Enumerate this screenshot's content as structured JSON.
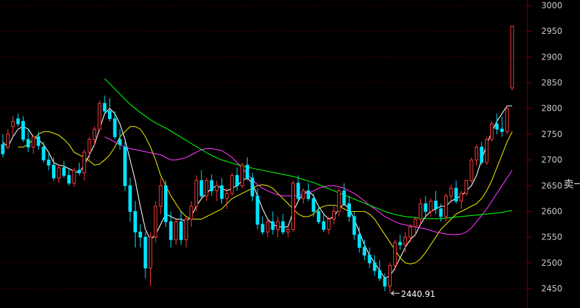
{
  "colors": {
    "background": "#000000",
    "grid": "#7a0000",
    "axis_text": "#c8c8c8",
    "up_candle": "#ff3c3c",
    "down_candle": "#00e5ff",
    "ma5": "#ffffff",
    "ma10": "#e6e600",
    "ma20": "#ff33ff",
    "ma60": "#00ff00",
    "annotation": "#ffffff"
  },
  "side_tab": {
    "label": "卖一"
  },
  "chart_data": {
    "type": "candlestick",
    "ylim": [
      2440,
      3000
    ],
    "y_ticks": [
      3000,
      2950,
      2900,
      2850,
      2800,
      2750,
      2700,
      2650,
      2600,
      2550,
      2500,
      2450
    ],
    "grid": true,
    "annotation": {
      "text": "2440.91",
      "value": 2440.91
    },
    "candles": [
      [
        2730,
        2750,
        2705,
        2712
      ],
      [
        2725,
        2760,
        2720,
        2750
      ],
      [
        2765,
        2785,
        2745,
        2775
      ],
      [
        2780,
        2790,
        2765,
        2770
      ],
      [
        2775,
        2785,
        2735,
        2740
      ],
      [
        2740,
        2760,
        2715,
        2725
      ],
      [
        2725,
        2748,
        2712,
        2745
      ],
      [
        2745,
        2755,
        2720,
        2728
      ],
      [
        2725,
        2735,
        2695,
        2700
      ],
      [
        2700,
        2712,
        2680,
        2690
      ],
      [
        2690,
        2705,
        2660,
        2665
      ],
      [
        2665,
        2690,
        2655,
        2685
      ],
      [
        2685,
        2698,
        2665,
        2670
      ],
      [
        2670,
        2682,
        2650,
        2655
      ],
      [
        2655,
        2685,
        2648,
        2680
      ],
      [
        2680,
        2695,
        2670,
        2675
      ],
      [
        2675,
        2720,
        2660,
        2715
      ],
      [
        2715,
        2745,
        2700,
        2740
      ],
      [
        2740,
        2765,
        2730,
        2760
      ],
      [
        2760,
        2815,
        2755,
        2810
      ],
      [
        2810,
        2825,
        2790,
        2795
      ],
      [
        2795,
        2820,
        2775,
        2780
      ],
      [
        2780,
        2795,
        2740,
        2745
      ],
      [
        2740,
        2760,
        2720,
        2730
      ],
      [
        2725,
        2735,
        2640,
        2650
      ],
      [
        2650,
        2665,
        2580,
        2600
      ],
      [
        2600,
        2620,
        2530,
        2560
      ],
      [
        2560,
        2575,
        2530,
        2550
      ],
      [
        2550,
        2560,
        2470,
        2490
      ],
      [
        2490,
        2560,
        2455,
        2550
      ],
      [
        2550,
        2620,
        2540,
        2610
      ],
      [
        2610,
        2665,
        2595,
        2650
      ],
      [
        2650,
        2660,
        2570,
        2580
      ],
      [
        2580,
        2600,
        2530,
        2545
      ],
      [
        2545,
        2585,
        2535,
        2580
      ],
      [
        2580,
        2600,
        2535,
        2545
      ],
      [
        2545,
        2590,
        2530,
        2585
      ],
      [
        2585,
        2620,
        2570,
        2610
      ],
      [
        2610,
        2670,
        2600,
        2660
      ],
      [
        2660,
        2680,
        2625,
        2630
      ],
      [
        2630,
        2665,
        2620,
        2660
      ],
      [
        2660,
        2672,
        2630,
        2640
      ],
      [
        2640,
        2660,
        2620,
        2650
      ],
      [
        2650,
        2665,
        2615,
        2625
      ],
      [
        2625,
        2645,
        2605,
        2635
      ],
      [
        2635,
        2675,
        2630,
        2670
      ],
      [
        2670,
        2685,
        2640,
        2650
      ],
      [
        2650,
        2695,
        2645,
        2690
      ],
      [
        2690,
        2705,
        2660,
        2665
      ],
      [
        2665,
        2675,
        2620,
        2630
      ],
      [
        2630,
        2645,
        2565,
        2575
      ],
      [
        2575,
        2590,
        2555,
        2560
      ],
      [
        2560,
        2585,
        2550,
        2580
      ],
      [
        2580,
        2600,
        2555,
        2565
      ],
      [
        2565,
        2590,
        2550,
        2580
      ],
      [
        2580,
        2595,
        2555,
        2560
      ],
      [
        2560,
        2575,
        2550,
        2565
      ],
      [
        2565,
        2660,
        2560,
        2655
      ],
      [
        2655,
        2670,
        2620,
        2625
      ],
      [
        2625,
        2645,
        2615,
        2640
      ],
      [
        2640,
        2655,
        2620,
        2625
      ],
      [
        2625,
        2635,
        2590,
        2600
      ],
      [
        2600,
        2610,
        2575,
        2580
      ],
      [
        2580,
        2595,
        2560,
        2565
      ],
      [
        2565,
        2590,
        2555,
        2585
      ],
      [
        2585,
        2610,
        2575,
        2600
      ],
      [
        2600,
        2645,
        2590,
        2640
      ],
      [
        2640,
        2655,
        2610,
        2615
      ],
      [
        2615,
        2630,
        2580,
        2590
      ],
      [
        2590,
        2600,
        2545,
        2555
      ],
      [
        2555,
        2570,
        2520,
        2530
      ],
      [
        2530,
        2545,
        2505,
        2515
      ],
      [
        2515,
        2530,
        2490,
        2500
      ],
      [
        2500,
        2515,
        2475,
        2485
      ],
      [
        2485,
        2505,
        2465,
        2470
      ],
      [
        2470,
        2480,
        2445,
        2455
      ],
      [
        2455,
        2500,
        2441,
        2495
      ],
      [
        2495,
        2545,
        2485,
        2540
      ],
      [
        2540,
        2555,
        2525,
        2535
      ],
      [
        2535,
        2560,
        2520,
        2550
      ],
      [
        2550,
        2575,
        2540,
        2570
      ],
      [
        2570,
        2590,
        2555,
        2585
      ],
      [
        2585,
        2625,
        2575,
        2615
      ],
      [
        2615,
        2630,
        2590,
        2600
      ],
      [
        2600,
        2625,
        2590,
        2620
      ],
      [
        2620,
        2640,
        2595,
        2605
      ],
      [
        2605,
        2615,
        2580,
        2590
      ],
      [
        2590,
        2635,
        2580,
        2630
      ],
      [
        2630,
        2652,
        2620,
        2645
      ],
      [
        2645,
        2660,
        2615,
        2620
      ],
      [
        2620,
        2640,
        2605,
        2635
      ],
      [
        2635,
        2662,
        2630,
        2660
      ],
      [
        2660,
        2705,
        2655,
        2700
      ],
      [
        2700,
        2730,
        2690,
        2725
      ],
      [
        2725,
        2735,
        2690,
        2695
      ],
      [
        2695,
        2745,
        2690,
        2740
      ],
      [
        2740,
        2775,
        2735,
        2770
      ],
      [
        2770,
        2790,
        2750,
        2760
      ],
      [
        2760,
        2785,
        2745,
        2755
      ],
      [
        2755,
        2805,
        2750,
        2800
      ],
      [
        2840,
        2960,
        2835,
        2960
      ]
    ],
    "series": [
      {
        "values": [
          2735,
          2725,
          2745,
          2760,
          2765,
          2760,
          2745,
          2740,
          2730,
          2715,
          2695,
          2690,
          2688,
          2683,
          2678,
          2675,
          2690,
          2710,
          2730,
          2760,
          2790,
          2800,
          2790,
          2770,
          2740,
          2700,
          2660,
          2610,
          2565,
          2545,
          2555,
          2575,
          2595,
          2590,
          2585,
          2585,
          2580,
          2590,
          2610,
          2625,
          2635,
          2645,
          2650,
          2645,
          2640,
          2645,
          2650,
          2660,
          2665,
          2655,
          2630,
          2605,
          2585,
          2575,
          2570,
          2570,
          2570,
          2600,
          2620,
          2635,
          2640,
          2630,
          2610,
          2595,
          2585,
          2590,
          2605,
          2615,
          2605,
          2585,
          2560,
          2535,
          2515,
          2500,
          2485,
          2470,
          2475,
          2490,
          2510,
          2530,
          2545,
          2555,
          2575,
          2590,
          2600,
          2605,
          2610,
          2610,
          2620,
          2625,
          2630,
          2640,
          2650,
          2670,
          2700,
          2730,
          2755,
          2775,
          2790,
          2805,
          2805
        ]
      },
      {
        "values": [
          2725,
          2725,
          2730,
          2740,
          2750,
          2755,
          2755,
          2752,
          2748,
          2740,
          2730,
          2715,
          2710,
          2705,
          2698,
          2690,
          2692,
          2700,
          2710,
          2725,
          2745,
          2755,
          2765,
          2765,
          2760,
          2745,
          2725,
          2700,
          2670,
          2650,
          2630,
          2615,
          2600,
          2590,
          2585,
          2585,
          2585,
          2590,
          2595,
          2600,
          2605,
          2615,
          2625,
          2630,
          2635,
          2640,
          2645,
          2650,
          2652,
          2650,
          2645,
          2635,
          2625,
          2615,
          2605,
          2595,
          2590,
          2590,
          2595,
          2605,
          2610,
          2612,
          2612,
          2610,
          2605,
          2600,
          2600,
          2600,
          2600,
          2595,
          2585,
          2570,
          2555,
          2540,
          2525,
          2510,
          2500,
          2498,
          2500,
          2508,
          2520,
          2535,
          2550,
          2565,
          2575,
          2585,
          2595,
          2600,
          2605,
          2610,
          2615,
          2625,
          2640,
          2660,
          2685,
          2710,
          2735,
          2755
        ]
      },
      {
        "values": [
          2745,
          2740,
          2735,
          2730,
          2725,
          2722,
          2720,
          2718,
          2716,
          2714,
          2712,
          2710,
          2705,
          2700,
          2700,
          2702,
          2705,
          2710,
          2715,
          2720,
          2722,
          2722,
          2720,
          2718,
          2712,
          2705,
          2695,
          2685,
          2672,
          2662,
          2652,
          2645,
          2640,
          2636,
          2632,
          2630,
          2630,
          2630,
          2632,
          2634,
          2636,
          2640,
          2645,
          2648,
          2650,
          2650,
          2648,
          2645,
          2640,
          2635,
          2628,
          2620,
          2612,
          2605,
          2598,
          2590,
          2585,
          2580,
          2576,
          2574,
          2572,
          2570,
          2568,
          2566,
          2563,
          2560,
          2558,
          2556,
          2555,
          2555,
          2556,
          2560,
          2568,
          2580,
          2592,
          2605,
          2620,
          2635,
          2650,
          2665,
          2680
        ]
      },
      {
        "values": [
          2858,
          2848,
          2838,
          2828,
          2818,
          2808,
          2800,
          2792,
          2785,
          2778,
          2772,
          2767,
          2762,
          2756,
          2750,
          2744,
          2738,
          2732,
          2726,
          2720,
          2714,
          2709,
          2704,
          2700,
          2697,
          2694,
          2691,
          2688,
          2686,
          2684,
          2682,
          2680,
          2678,
          2676,
          2674,
          2672,
          2670,
          2668,
          2665,
          2662,
          2659,
          2656,
          2652,
          2648,
          2644,
          2640,
          2636,
          2632,
          2628,
          2624,
          2620,
          2616,
          2612,
          2608,
          2604,
          2600,
          2597,
          2594,
          2592,
          2590,
          2589,
          2588,
          2587,
          2586,
          2586,
          2586,
          2586,
          2587,
          2588,
          2589,
          2590,
          2591,
          2592,
          2593,
          2594,
          2595,
          2596,
          2597,
          2598,
          2600,
          2602
        ]
      }
    ]
  }
}
